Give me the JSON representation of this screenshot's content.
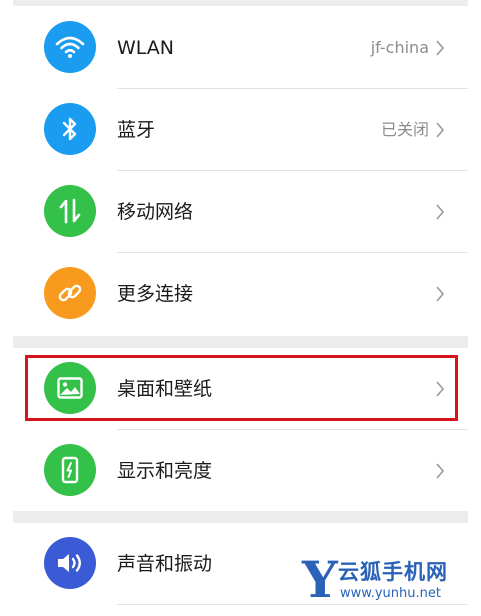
{
  "settings": {
    "wlan": {
      "label": "WLAN",
      "value": "jf-china",
      "icon": "wifi-icon",
      "color": "#1a9cf0"
    },
    "bluetooth": {
      "label": "蓝牙",
      "value": "已关闭",
      "icon": "bluetooth-icon",
      "color": "#1a9cf0"
    },
    "mobile_network": {
      "label": "移动网络",
      "icon": "mobile-data-icon",
      "color": "#33c14a"
    },
    "more_connections": {
      "label": "更多连接",
      "icon": "link-icon",
      "color": "#f79a1d"
    },
    "wallpaper": {
      "label": "桌面和壁纸",
      "icon": "image-icon",
      "color": "#33c14a",
      "highlighted": true
    },
    "display": {
      "label": "显示和亮度",
      "icon": "brightness-icon",
      "color": "#33c14a"
    },
    "sound": {
      "label": "声音和振动",
      "icon": "speaker-icon",
      "color": "#3b5bd6"
    }
  },
  "watermark": {
    "letter": "Y",
    "title": "云狐手机网",
    "url": "www.yunhu.net"
  },
  "colors": {
    "highlight": "#d8141b",
    "section_band": "#ececec",
    "watermark": "#2a62b8"
  }
}
